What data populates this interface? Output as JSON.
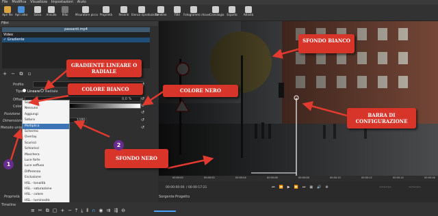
{
  "menubar": [
    "File",
    "Modifica",
    "Visualizza",
    "Impostazioni",
    "Aiuto"
  ],
  "toolbar": [
    {
      "label": "Apri file",
      "icon": "folder-icon",
      "color": "#d9a441"
    },
    {
      "label": "Apri altro",
      "icon": "open-other-icon",
      "color": "#4a90d9"
    },
    {
      "label": "Salva",
      "icon": "save-icon",
      "color": "#cfcfcf"
    },
    {
      "label": "Annulla",
      "icon": "undo-icon",
      "color": "#cfcfcf"
    },
    {
      "label": "Rifai",
      "icon": "redo-icon",
      "color": "#777777"
    },
    {
      "label": "Misuratore picco",
      "icon": "peak-meter-icon",
      "color": "#cfcfcf"
    },
    {
      "label": "Proprietà",
      "icon": "info-icon",
      "color": "#cfcfcf"
    },
    {
      "label": "Recenti",
      "icon": "clock-icon",
      "color": "#cfcfcf"
    },
    {
      "label": "Elenco riproduzione",
      "icon": "list-icon",
      "color": "#cfcfcf"
    },
    {
      "label": "Timeline",
      "icon": "timeline-icon",
      "color": "#cfcfcf"
    },
    {
      "label": "Filtri",
      "icon": "filter-icon",
      "color": "#cfcfcf"
    },
    {
      "label": "Fotogrammi chiave",
      "icon": "keyframe-icon",
      "color": "#cfcfcf"
    },
    {
      "label": "Cronologia",
      "icon": "history-icon",
      "color": "#cfcfcf"
    },
    {
      "label": "Esporta",
      "icon": "export-icon",
      "color": "#cfcfcf"
    },
    {
      "label": "Attività",
      "icon": "jobs-icon",
      "color": "#cfcfcf"
    }
  ],
  "filters": {
    "panel_title": "Filtri",
    "clip_name": "passanti.mp4",
    "list_header": "Video",
    "items": [
      "✓ Gradiente"
    ]
  },
  "profile": {
    "profilo_label": "Profilo",
    "tipo_label": "Tipo",
    "tipo_options": [
      "Lineare",
      "Radiale"
    ],
    "offset_label": "Offset",
    "offset_value": "0,0 %",
    "colori_label": "Colori",
    "posizione_label": "Posizione",
    "dimensione_label": "Dimensione",
    "value_1080": "1080",
    "metodo_label": "Metodo unione"
  },
  "blend_modes": [
    "Sopra",
    "Nessuno",
    "Aggiungi",
    "Satura",
    "Moltiplica",
    "Schermo",
    "Overlay",
    "Scurisci",
    "Schiarisci",
    "Maschera",
    "Luce forte",
    "Luce soffusa",
    "Differenza",
    "Esclusione",
    "HSL - tonalità",
    "HSL - saturazione",
    "HSL - colore",
    "HSL - luminosità"
  ],
  "selected_blend_index": 4,
  "bottom_left": {
    "prop_tab": "Proprietà",
    "timeline": "Timeline"
  },
  "transport": {
    "time_current": "00:00:00:00",
    "time_total": "/ 00:00:17:21",
    "ruler": [
      "00:00:00",
      "00:00:02",
      "00:00:04",
      "00:00:06",
      "00:00:08",
      "00:00:10",
      "00:00:12",
      "00:00:14",
      "00:00:16"
    ],
    "in_out_left": "--:--:--:--",
    "in_out_right": "--:--:--:--"
  },
  "tabs": [
    "Sorgente",
    "Progetto"
  ],
  "annotations": {
    "sfondo_bianco": "SFONDO BIANCO",
    "gradiente": "GRADIENTE LINEARE O RADIALE",
    "colore_bianco": "COLORE BIANCO",
    "colore_nero": "COLORE NERO",
    "barra": "BARRA DI CONFIGURAZIONE",
    "sfondo_nero": "SFONDO NERO",
    "num1": "1",
    "num2": "2"
  },
  "colors": {
    "accent_red": "#d8352a",
    "selection_blue": "#3c75b6",
    "badge_purple": "#6a2b8e"
  }
}
